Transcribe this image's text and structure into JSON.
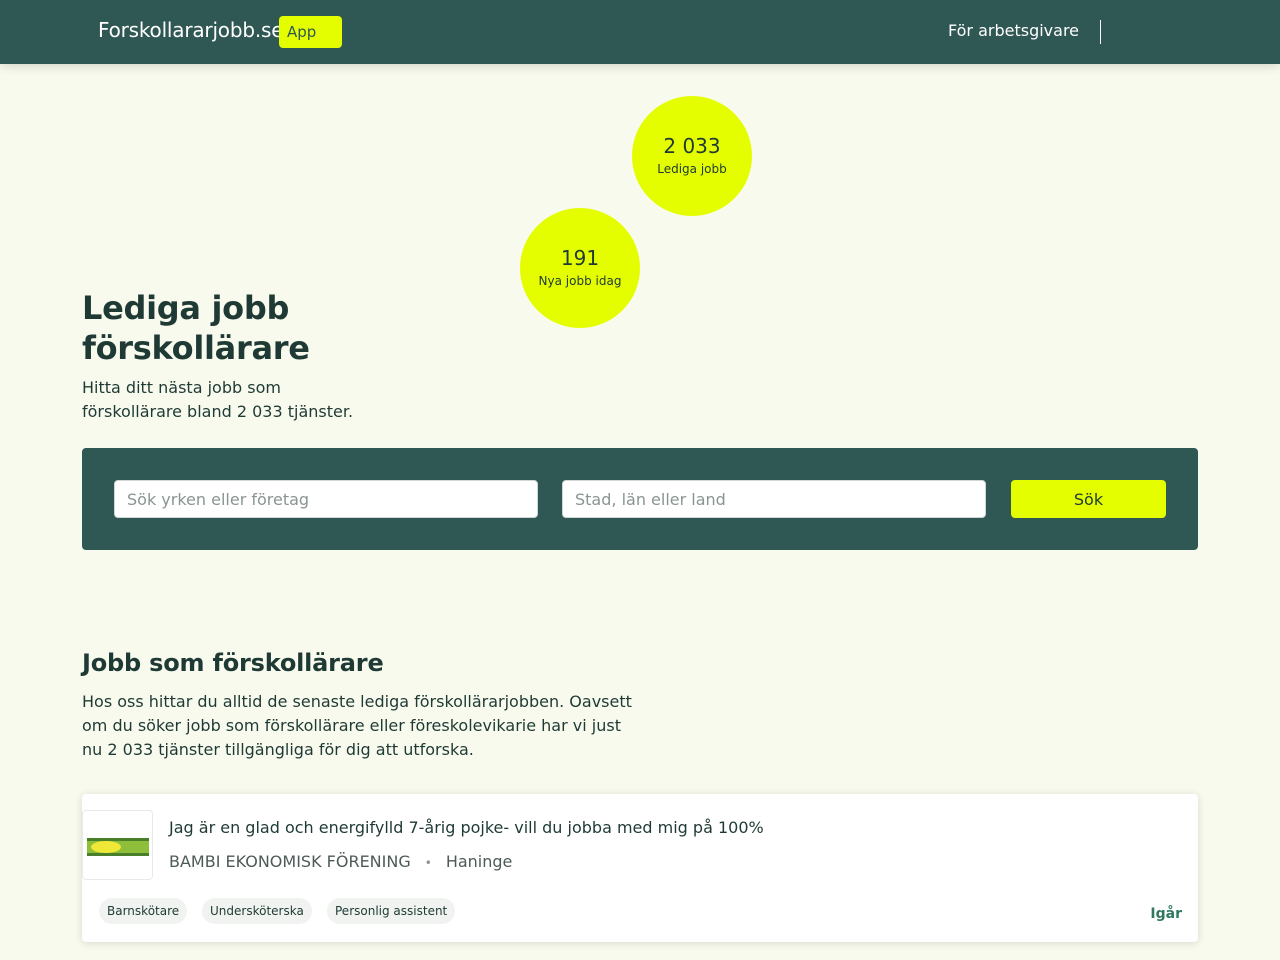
{
  "header": {
    "brand": "Forskollararjobb.se",
    "app_badge": "App",
    "employer_link": "För arbetsgivare"
  },
  "stats": [
    {
      "value": "2 033",
      "label": "Lediga jobb"
    },
    {
      "value": "191",
      "label": "Nya jobb idag"
    }
  ],
  "hero": {
    "title": "Lediga jobb förskollärare",
    "subtitle": "Hitta ditt nästa jobb som förskollärare bland 2 033 tjänster."
  },
  "search": {
    "query_placeholder": "Sök yrken eller företag",
    "location_placeholder": "Stad, län eller land",
    "button_label": "Sök"
  },
  "section": {
    "title": "Jobb som förskollärare",
    "text": "Hos oss hittar du alltid de senaste lediga förskollärarjobben. Oavsett om du söker jobb som förskollärare eller föreskolevikarie har vi just nu 2 033 tjänster tillgängliga för dig att utforska."
  },
  "jobs": [
    {
      "title": "Jag är en glad och energifylld 7-årig pojke- vill du jobba med mig på 100%",
      "company": "BAMBI EKONOMISK FÖRENING",
      "separator": "•",
      "location": "Haninge",
      "tags": [
        "Barnskötare",
        "Undersköterska",
        "Personlig assistent"
      ],
      "date": "Igår"
    }
  ],
  "colors": {
    "brand_dark": "#2f5753",
    "accent": "#e4fe00",
    "background": "#f8faee",
    "date_green": "#2f7a5e"
  }
}
